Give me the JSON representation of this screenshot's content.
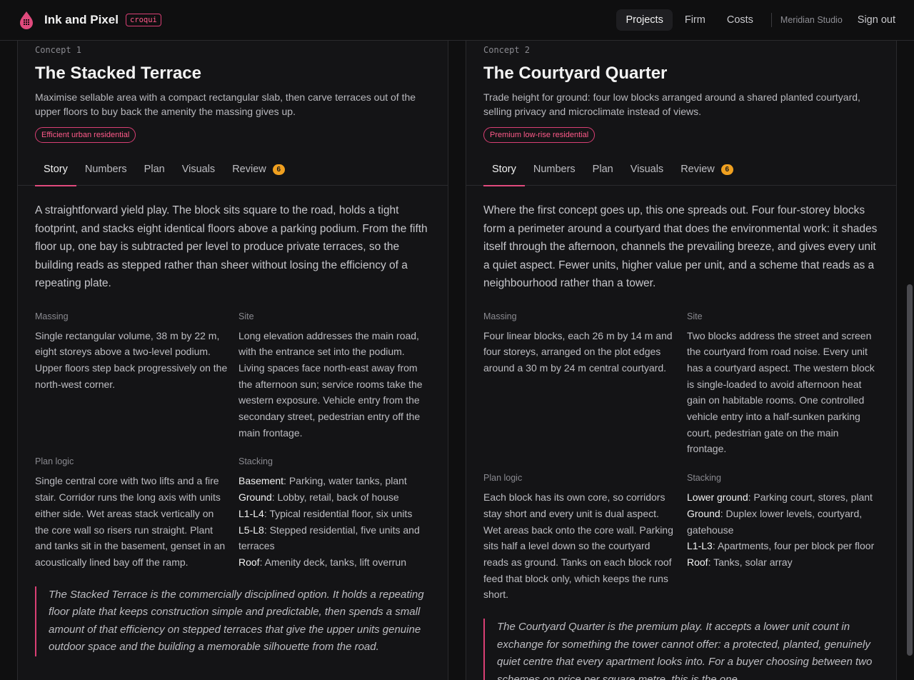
{
  "header": {
    "brand": "Ink and Pixel",
    "tag": "croqui",
    "nav": [
      "Projects",
      "Firm",
      "Costs"
    ],
    "studio": "Meridian Studio",
    "signout": "Sign out",
    "accent": "#e04a7d"
  },
  "concepts": [
    {
      "label": "Concept 1",
      "title": "The Stacked Terrace",
      "subtitle": "Maximise sellable area with a compact rectangular slab, then carve terraces out of the upper floors to buy back the amenity the massing gives up.",
      "pill": "Efficient urban residential",
      "tabs": [
        "Story",
        "Numbers",
        "Plan",
        "Visuals",
        "Review"
      ],
      "review_badge": "6",
      "lead": "A straightforward yield play. The block sits square to the road, holds a tight footprint, and stacks eight identical floors above a parking podium. From the fifth floor up, one bay is subtracted per level to produce private terraces, so the building reads as stepped rather than sheer without losing the efficiency of a repeating plate.",
      "massing_label": "Massing",
      "massing": "Single rectangular volume, 38 m by 22 m, eight storeys above a two-level podium. Upper floors step back progressively on the north-west corner.",
      "site_label": "Site",
      "site": "Long elevation addresses the main road, with the entrance set into the podium. Living spaces face north-east away from the afternoon sun; service rooms take the western exposure. Vehicle entry from the secondary street, pedestrian entry off the main frontage.",
      "plan_label": "Plan logic",
      "plan": "Single central core with two lifts and a fire stair. Corridor runs the long axis with units either side. Wet areas stack vertically on the core wall so risers run straight. Plant and tanks sit in the basement, genset in an acoustically lined bay off the ramp.",
      "stacking_label": "Stacking",
      "stacking": [
        {
          "key": "Basement",
          "value": ": Parking, water tanks, plant"
        },
        {
          "key": "Ground",
          "value": ": Lobby, retail, back of house"
        },
        {
          "key": "L1-L4",
          "value": ": Typical residential floor, six units"
        },
        {
          "key": "L5-L8",
          "value": ": Stepped residential, five units and terraces"
        },
        {
          "key": "Roof",
          "value": ": Amenity deck, tanks, lift overrun"
        }
      ],
      "quote": "The Stacked Terrace is the commercially disciplined option. It holds a repeating floor plate that keeps construction simple and predictable, then spends a small amount of that efficiency on stepped terraces that give the upper units genuine outdoor space and the building a memorable silhouette from the road."
    },
    {
      "label": "Concept 2",
      "title": "The Courtyard Quarter",
      "subtitle": "Trade height for ground: four low blocks arranged around a shared planted courtyard, selling privacy and microclimate instead of views.",
      "pill": "Premium low-rise residential",
      "tabs": [
        "Story",
        "Numbers",
        "Plan",
        "Visuals",
        "Review"
      ],
      "review_badge": "6",
      "lead": "Where the first concept goes up, this one spreads out. Four four-storey blocks form a perimeter around a courtyard that does the environmental work: it shades itself through the afternoon, channels the prevailing breeze, and gives every unit a quiet aspect. Fewer units, higher value per unit, and a scheme that reads as a neighbourhood rather than a tower.",
      "massing_label": "Massing",
      "massing": "Four linear blocks, each 26 m by 14 m and four storeys, arranged on the plot edges around a 30 m by 24 m central courtyard.",
      "site_label": "Site",
      "site": "Two blocks address the street and screen the courtyard from road noise. Every unit has a courtyard aspect. The western block is single-loaded to avoid afternoon heat gain on habitable rooms. One controlled vehicle entry into a half-sunken parking court, pedestrian gate on the main frontage.",
      "plan_label": "Plan logic",
      "plan": "Each block has its own core, so corridors stay short and every unit is dual aspect. Wet areas back onto the core wall. Parking sits half a level down so the courtyard reads as ground. Tanks on each block roof feed that block only, which keeps the runs short.",
      "stacking_label": "Stacking",
      "stacking": [
        {
          "key": "Lower ground",
          "value": ": Parking court, stores, plant"
        },
        {
          "key": "Ground",
          "value": ": Duplex lower levels, courtyard, gatehouse"
        },
        {
          "key": "L1-L3",
          "value": ": Apartments, four per block per floor"
        },
        {
          "key": "Roof",
          "value": ": Tanks, solar array"
        }
      ],
      "quote": "The Courtyard Quarter is the premium play. It accepts a lower unit count in exchange for something the tower cannot offer: a protected, planted, genuinely quiet centre that every apartment looks into. For a buyer choosing between two schemes on price per square metre, this is the one"
    }
  ]
}
